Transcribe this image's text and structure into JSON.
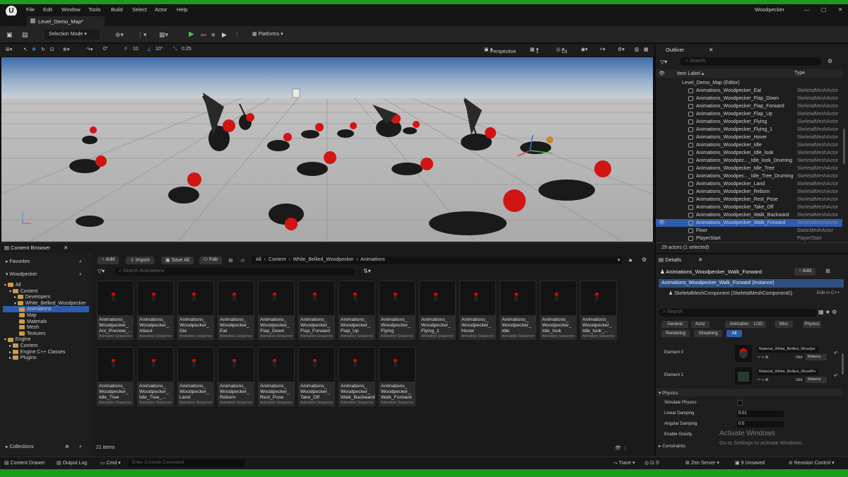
{
  "window": {
    "title": "Woodpecker",
    "minimize": "—",
    "maximize": "▢",
    "close": "✕"
  },
  "menu": [
    "File",
    "Edit",
    "Window",
    "Tools",
    "Build",
    "Select",
    "Actor",
    "Help"
  ],
  "doc_tab": "Level_Demo_Map*",
  "toolbar": {
    "mode": "Selection Mode",
    "platforms": "Platforms"
  },
  "viewport_toolbar": {
    "rotate": "0°",
    "snap": "10",
    "angle": "10°",
    "scale": "0.25",
    "perspective": "Perspective",
    "cameras": "1",
    "lit": "Lit"
  },
  "outliner": {
    "tab": "Outliner",
    "search_placeholder": "Search",
    "col_label": "Item Label",
    "col_type": "Type",
    "root": "Level_Demo_Map (Editor)",
    "rows": [
      {
        "label": "Animations_Woodpecker_Eat",
        "type": "SkeletalMeshActor"
      },
      {
        "label": "Animations_Woodpecker_Flap_Down",
        "type": "SkeletalMeshActor"
      },
      {
        "label": "Animations_Woodpecker_Flap_Forward",
        "type": "SkeletalMeshActor"
      },
      {
        "label": "Animations_Woodpecker_Flap_Up",
        "type": "SkeletalMeshActor"
      },
      {
        "label": "Animations_Woodpecker_Flying",
        "type": "SkeletalMeshActor"
      },
      {
        "label": "Animations_Woodpecker_Flying_1",
        "type": "SkeletalMeshActor"
      },
      {
        "label": "Animations_Woodpecker_Hover",
        "type": "SkeletalMeshActor"
      },
      {
        "label": "Animations_Woodpecker_Idle",
        "type": "SkeletalMeshActor"
      },
      {
        "label": "Animations_Woodpecker_Idle_look",
        "type": "SkeletalMeshActor"
      },
      {
        "label": "Animations_Woodpec..._Idle_look_Druming",
        "type": "SkeletalMeshActor"
      },
      {
        "label": "Animations_Woodpecker_Idle_Tree",
        "type": "SkeletalMeshActor"
      },
      {
        "label": "Animations_Woodpec..._Idle_Tree_Druming",
        "type": "SkeletalMeshActor"
      },
      {
        "label": "Animations_Woodpecker_Land",
        "type": "SkeletalMeshActor"
      },
      {
        "label": "Animations_Woodpecker_Reborn",
        "type": "SkeletalMeshActor"
      },
      {
        "label": "Animations_Woodpecker_Rest_Pose",
        "type": "SkeletalMeshActor"
      },
      {
        "label": "Animations_Woodpecker_Take_Off",
        "type": "SkeletalMeshActor"
      },
      {
        "label": "Animations_Woodpecker_Walk_Backward",
        "type": "SkeletalMeshActor"
      },
      {
        "label": "Animations_Woodpecker_Walk_Forward",
        "type": "SkeletalMeshActor"
      },
      {
        "label": "Floor",
        "type": "StaticMeshActor"
      },
      {
        "label": "PlayerStart",
        "type": "PlayerStart"
      }
    ],
    "status": "29 actors (1 selected)"
  },
  "content_browser": {
    "tab": "Content Browser",
    "favorites": "Favorites",
    "project": "Woodpecker",
    "add": "Add",
    "import": "Import",
    "save_all": "Save All",
    "fab": "Fab",
    "path": [
      "All",
      "Content",
      "White_Bellied_Woodpecker",
      "Animations"
    ],
    "search_placeholder": "Search Animations",
    "collections": "Collections",
    "item_count": "21 items",
    "tree": [
      "All",
      "Content",
      "Developers",
      "White_Bellied_Woodpecker",
      "Animations",
      "Map",
      "Materials",
      "Mesh",
      "Textures",
      "Engine",
      "Content",
      "Engine C++ Classes",
      "Plugins"
    ],
    "asset_type": "Animation Sequence",
    "assets": [
      "Animations_ Woodpecker_ Ani_Preview_...",
      "Animations_ Woodpecker_ Attack",
      "Animations_ Woodpecker_ Die",
      "Animations_ Woodpecker_ Eat",
      "Animations_ Woodpecker_ Flap_Down",
      "Animations_ Woodpecker_ Flap_Forward",
      "Animations_ Woodpecker_ Flap_Up",
      "Animations_ Woodpecker_ Flying",
      "Animations_ Woodpecker_ Flying_1",
      "Animations_ Woodpecker_ Hover",
      "Animations_ Woodpecker_ Idle",
      "Animations_ Woodpecker_ Idle_look",
      "Animations_ Woodpecker_ Idle_look_...",
      "Animations_ Woodpecker_ Idle_Tree",
      "Animations_ Woodpecker_ Idle_Tree_...",
      "Animations_ Woodpecker_ Land",
      "Animations_ Woodpecker_ Reborn",
      "Animations_ Woodpecker_ Rest_Pose",
      "Animations_ Woodpecker_ Take_Off",
      "Animations_ Woodpecker_ Walk_Backward",
      "Animations_ Woodpecker_ Walk_Forward"
    ]
  },
  "details": {
    "tab": "Details",
    "actor": "Animations_Woodpecker_Walk_Forward",
    "add": "Add",
    "instance": "Animations_Woodpecker_Walk_Forward (Instance)",
    "component": "SkeletalMeshComponent (SkeletalMeshComponent0)",
    "edit_cpp": "Edit in C++",
    "search_placeholder": "Search",
    "chips": [
      "General",
      "Actor",
      "Animation",
      "LOD",
      "Misc",
      "Physics",
      "Rendering",
      "Streaming",
      "All"
    ],
    "element0": "Element 0",
    "element1": "Element 1",
    "mat0": "Material_White_Bellied_Woodpe",
    "mat1": "Material_White_Bellied_WoodPe",
    "slot": "Slot",
    "materia": "Materia",
    "physics": "Physics",
    "simulate": "Simulate Physics",
    "linear": "Linear Damping",
    "linear_val": "0.01",
    "angular": "Angular Damping",
    "angular_val": "0.0",
    "gravity": "Enable Gravity",
    "constraints": "Constraints",
    "watermark1": "Activate Windows",
    "watermark2": "Go to Settings to activate Windows."
  },
  "statusbar": {
    "drawer": "Content Drawer",
    "output": "Output Log",
    "cmd": "Cmd",
    "console": "Enter Console Command",
    "trace": "Trace",
    "zen": "Zen Server",
    "unsaved": "9 Unsaved",
    "revision": "Revision Control"
  },
  "colors": {
    "accent": "#1d9b1d",
    "select": "#2f5caa",
    "play": "#3ec43e"
  }
}
